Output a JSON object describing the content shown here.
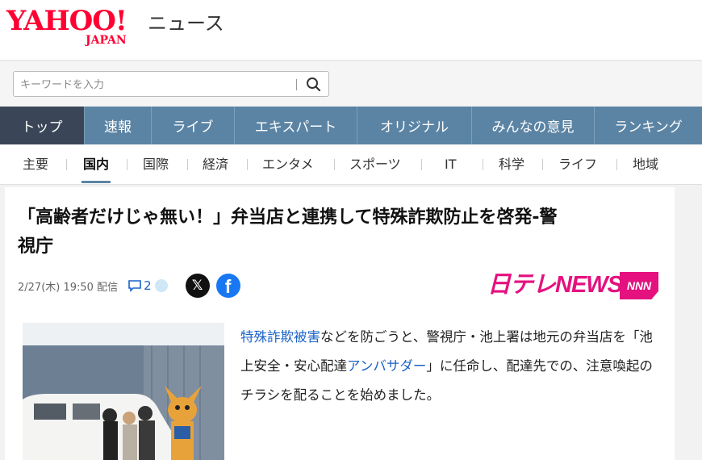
{
  "header": {
    "logo_main": "YAHOO!",
    "logo_sub": "JAPAN",
    "logo_news": "ニュース"
  },
  "search": {
    "placeholder": "キーワードを入力",
    "icon": "search-icon"
  },
  "main_nav": [
    {
      "label": "トップ",
      "active": true
    },
    {
      "label": "速報",
      "active": false
    },
    {
      "label": "ライブ",
      "active": false
    },
    {
      "label": "エキスパート",
      "active": false
    },
    {
      "label": "オリジナル",
      "active": false
    },
    {
      "label": "みんなの意見",
      "active": false
    },
    {
      "label": "ランキング",
      "active": false
    }
  ],
  "sub_nav": [
    {
      "label": "主要",
      "active": false
    },
    {
      "label": "国内",
      "active": true
    },
    {
      "label": "国際",
      "active": false
    },
    {
      "label": "経済",
      "active": false
    },
    {
      "label": "エンタメ",
      "active": false
    },
    {
      "label": "スポーツ",
      "active": false
    },
    {
      "label": "IT",
      "active": false
    },
    {
      "label": "科学",
      "active": false
    },
    {
      "label": "ライフ",
      "active": false
    },
    {
      "label": "地域",
      "active": false
    }
  ],
  "article": {
    "headline_line1": "「高齢者だけじゃ無い！」弁当店と連携して特殊詐欺防止を啓発-警",
    "headline_line2": "視庁",
    "date": "2/27(木) 19:50 配信",
    "comment_count": "2",
    "share_x": "𝕏",
    "share_fb": "f",
    "source_name": "日テレNEWS",
    "source_badge": "NNN",
    "body_link1": "特殊詐欺被害",
    "body_text1": "などを防ごうと、警視庁・池上署は地元の弁当店を「池上安全・安心配達",
    "body_link2": "アンバサダー",
    "body_text2": "」に任命し、配達先での、注意喚起のチラシを配ることを始めました。"
  },
  "colors": {
    "brand_red": "#ff0033",
    "nav_blue": "#5b84a4",
    "nav_active": "#3a4657",
    "link_blue": "#1a62c7",
    "ntv_pink": "#e4117f"
  }
}
